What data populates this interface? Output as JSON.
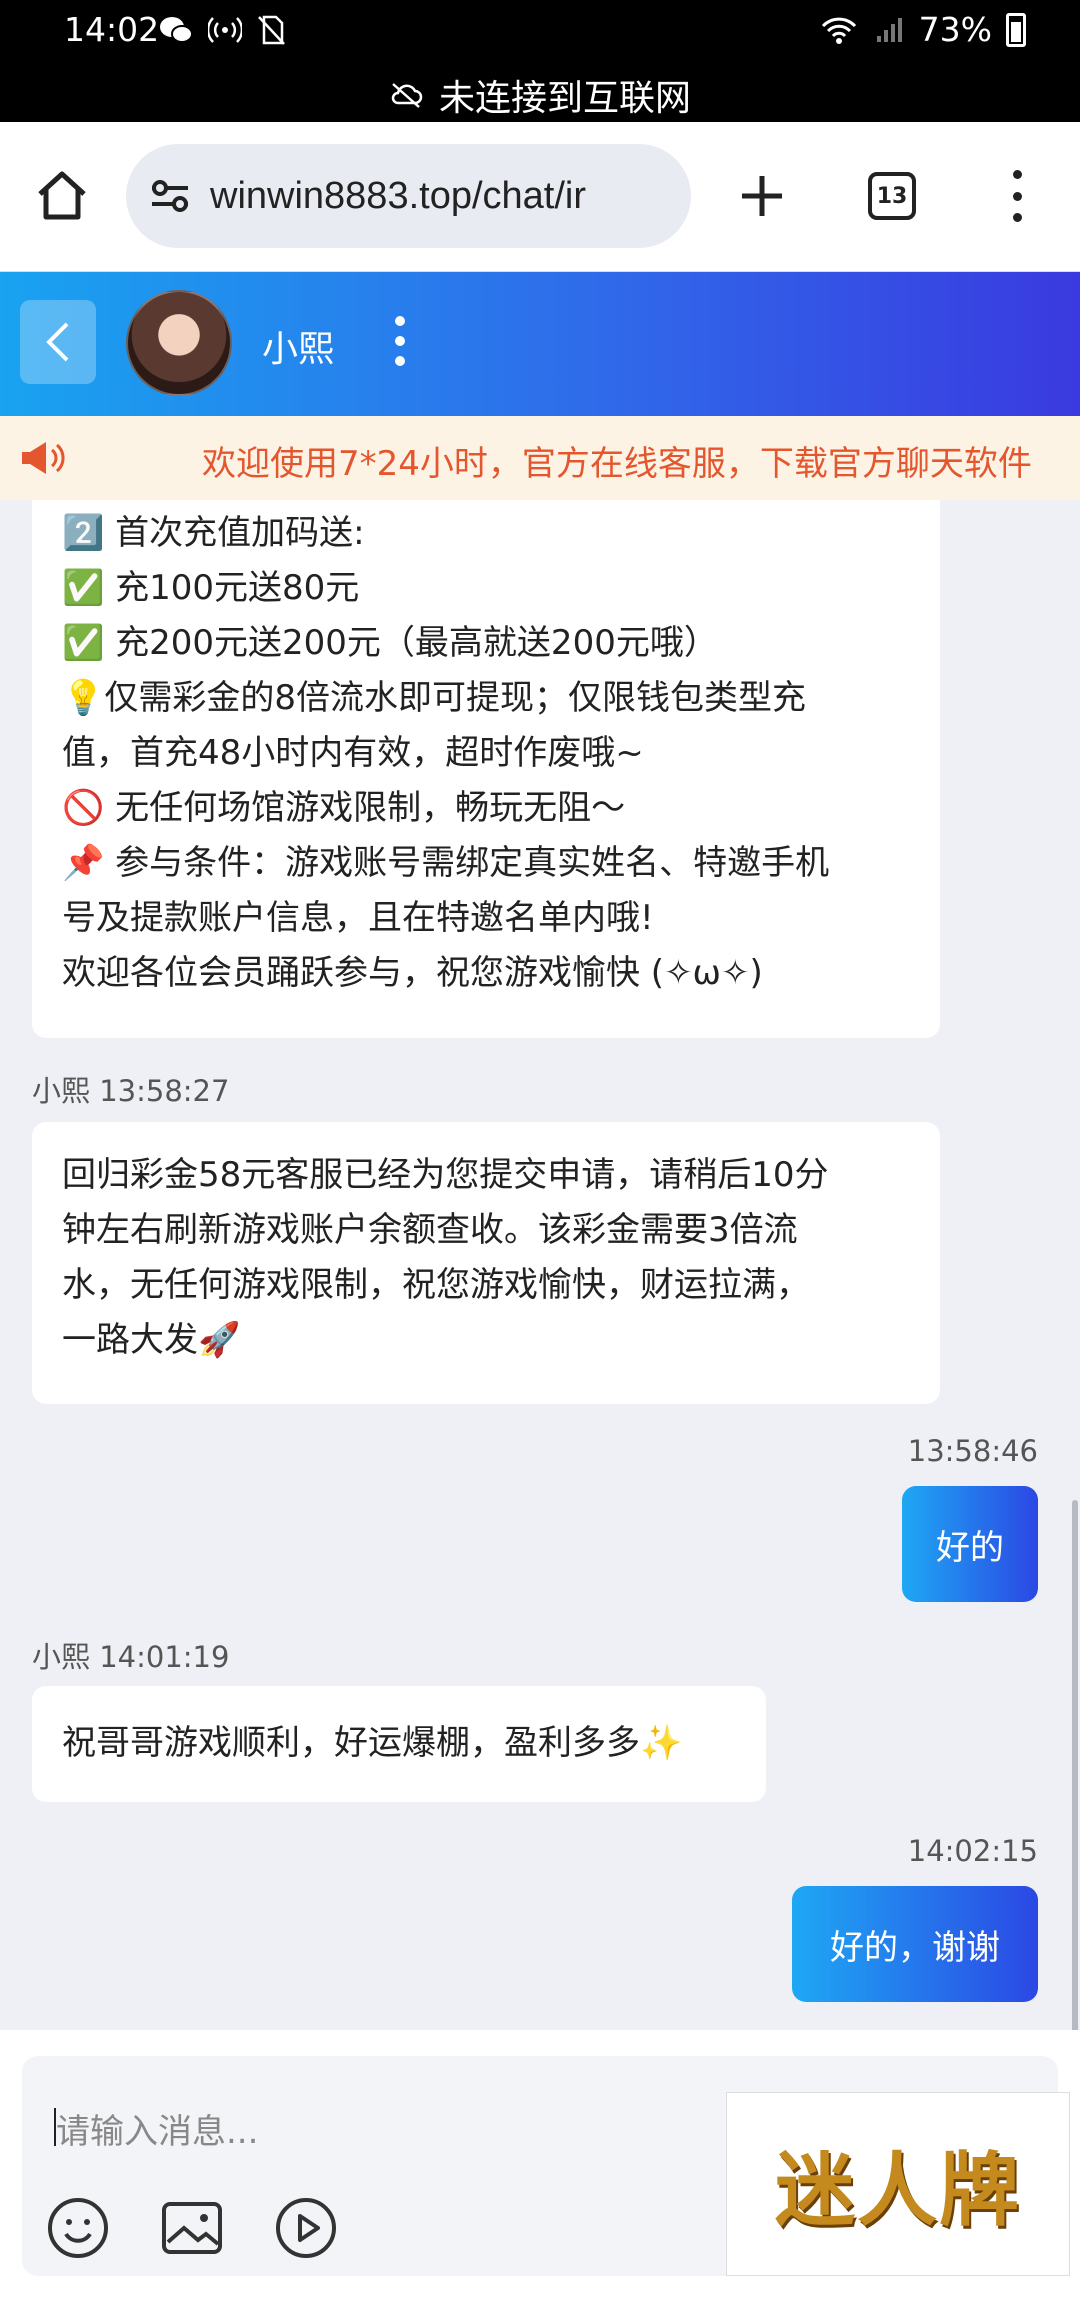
{
  "status_bar": {
    "time": "14:02",
    "battery": "73%"
  },
  "offline_banner": {
    "text": "未连接到互联网"
  },
  "browser": {
    "url": "winwin8883.top/chat/ir",
    "tab_count": "13"
  },
  "chat_header": {
    "contact_name": "小熙"
  },
  "notice": {
    "text": "欢迎使用7*24小时，官方在线客服，下载官方聊天软件"
  },
  "messages": [
    {
      "side": "left",
      "lines": [
        "2️⃣ 首次充值加码送:",
        "✅ 充100元送80元",
        "✅ 充200元送200元（最高就送200元哦）",
        "💡仅需彩金的8倍流水即可提现；仅限钱包类型充",
        "值，首充48小时内有效，超时作废哦~",
        "🚫 无任何场馆游戏限制，畅玩无阻～",
        "📌 参与条件：游戏账号需绑定真实姓名、特邀手机",
        "号及提款账户信息，且在特邀名单内哦!",
        "欢迎各位会员踊跃参与，祝您游戏愉快 (✧ω✧)"
      ]
    },
    {
      "side": "left",
      "meta": "小熙 13:58:27",
      "lines": [
        "回归彩金58元客服已经为您提交申请，请稍后10分",
        "钟左右刷新游戏账户余额查收。该彩金需要3倍流",
        "水，无任何游戏限制，祝您游戏愉快，财运拉满，",
        "一路大发🚀"
      ]
    },
    {
      "side": "right",
      "meta": "13:58:46",
      "text": "好的"
    },
    {
      "side": "left",
      "meta": "小熙 14:01:19",
      "lines": [
        "祝哥哥游戏顺利，好运爆棚，盈利多多✨"
      ]
    },
    {
      "side": "right",
      "meta": "14:02:15",
      "text": "好的，谢谢"
    }
  ],
  "composer": {
    "placeholder": "请输入消息..."
  },
  "brand": {
    "text": "迷人牌"
  },
  "icons": {
    "status": [
      "wechat-icon",
      "hotspot-icon",
      "no-sim-icon",
      "wifi-icon",
      "signal-icon",
      "battery-icon"
    ],
    "browser": [
      "home-icon",
      "site-settings-icon",
      "new-tab-icon",
      "tab-switcher-icon",
      "more-vert-icon"
    ],
    "chat": [
      "back-icon",
      "avatar",
      "more-vert-icon",
      "megaphone-icon"
    ],
    "composer": [
      "emoji-icon",
      "image-icon",
      "video-icon"
    ]
  }
}
